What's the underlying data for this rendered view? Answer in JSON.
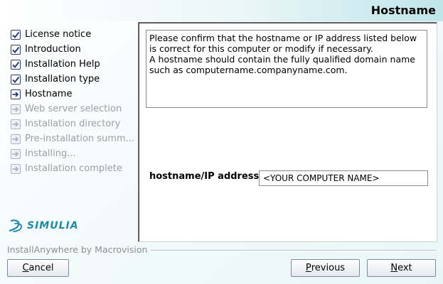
{
  "header": {
    "title": "Hostname"
  },
  "steps": [
    {
      "label": "License notice",
      "state": "done"
    },
    {
      "label": "Introduction",
      "state": "done"
    },
    {
      "label": "Installation Help",
      "state": "done"
    },
    {
      "label": "Installation type",
      "state": "done"
    },
    {
      "label": "Hostname",
      "state": "current"
    },
    {
      "label": "Web server selection",
      "state": "pending"
    },
    {
      "label": "Installation directory",
      "state": "pending"
    },
    {
      "label": "Pre-installation summ...",
      "state": "pending"
    },
    {
      "label": "Installing...",
      "state": "pending"
    },
    {
      "label": "Installation complete",
      "state": "pending"
    }
  ],
  "logo": {
    "text": "SIMULIA"
  },
  "content": {
    "info_lines": [
      "Please confirm that the hostname or IP address listed below",
      "is correct for this computer or modify if necessary.",
      "A hostname should contain the fully qualified domain name",
      "such as computername.companyname.com."
    ],
    "field_label": "hostname/IP address",
    "field_value": "<YOUR COMPUTER NAME>"
  },
  "footer": {
    "brand": "InstallAnywhere by Macrovision",
    "cancel": {
      "mnemonic": "C",
      "rest": "ancel"
    },
    "previous": {
      "mnemonic": "P",
      "rest": "revious"
    },
    "next": {
      "mnemonic": "N",
      "rest": "ext"
    }
  },
  "colors": {
    "accent": "#2a3c7a",
    "logo": "#1f8aa8",
    "pending": "#9aa0a6"
  }
}
